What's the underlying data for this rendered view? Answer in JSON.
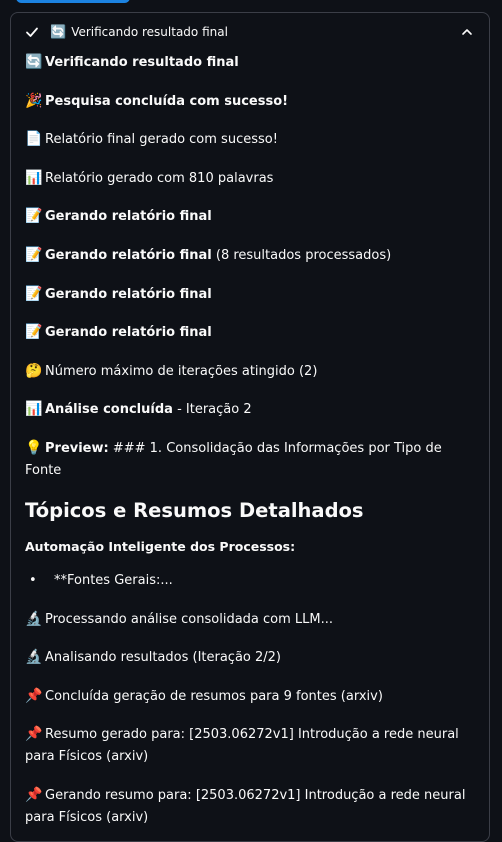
{
  "panel": {
    "title_emoji": "🔄",
    "title": "Verificando resultado final"
  },
  "messages": [
    {
      "emoji": "🔄",
      "bold": "Verificando resultado final",
      "text": ""
    },
    {
      "emoji": "🎉",
      "bold": "Pesquisa concluída com sucesso!",
      "text": ""
    },
    {
      "emoji": "📄",
      "bold": "",
      "text": "Relatório final gerado com sucesso!"
    },
    {
      "emoji": "📊",
      "bold": "",
      "text": "Relatório gerado com 810 palavras"
    },
    {
      "emoji": "📝",
      "bold": "Gerando relatório final",
      "text": ""
    },
    {
      "emoji": "📝",
      "bold": "Gerando relatório final",
      "text": " (8 resultados processados)"
    },
    {
      "emoji": "📝",
      "bold": "Gerando relatório final",
      "text": ""
    },
    {
      "emoji": "📝",
      "bold": "Gerando relatório final",
      "text": ""
    },
    {
      "emoji": "🤔",
      "bold": "",
      "text": "Número máximo de iterações atingido (2)"
    },
    {
      "emoji": "📊",
      "bold": "Análise concluída",
      "text": " - Iteração 2"
    },
    {
      "emoji": "💡",
      "bold": "Preview:",
      "text": " ### 1. Consolidação das Informações por Tipo de Fonte"
    }
  ],
  "heading": "Tópicos e Resumos Detalhados",
  "subheading": "Automação Inteligente dos Processos:",
  "bullet": {
    "dot": "•",
    "text": "**Fontes Gerais:..."
  },
  "messages2": [
    {
      "emoji": "🔬",
      "text": "Processando análise consolidada com LLM..."
    },
    {
      "emoji": "🔬",
      "text": "Analisando resultados (Iteração 2/2)"
    },
    {
      "emoji": "📌",
      "text": "Concluída geração de resumos para 9 fontes (arxiv)"
    },
    {
      "emoji": "📌",
      "text": "Resumo gerado para: [2503.06272v1] Introdução a rede neural para Físicos (arxiv)"
    },
    {
      "emoji": "📌",
      "text": "Gerando resumo para: [2503.06272v1] Introdução a rede neural para Físicos (arxiv)"
    }
  ]
}
